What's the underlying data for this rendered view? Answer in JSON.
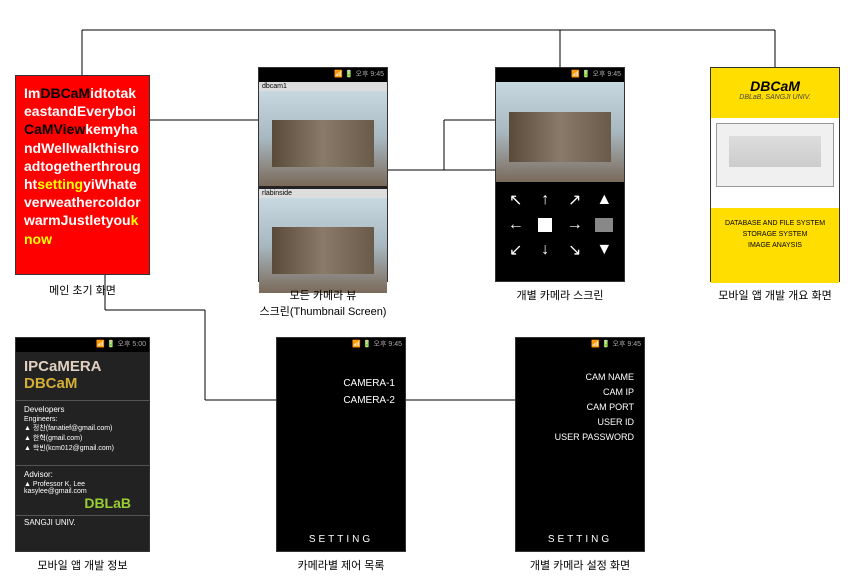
{
  "statusbar_text": "📶 🔋 오후 9:45",
  "main_screen": {
    "text_full": "ImDBCaMidtotakeastandEveryboiCaMViewkemyhandWellwalkthisroadtogetherthroughtsettingyiWhateverweathercoldorwarmJustletyouknow",
    "highlights": {
      "dbcam": "DBCaM",
      "camview": "CaMView",
      "setting": "setting",
      "know": "know"
    },
    "label": "메인 초기 화면"
  },
  "thumb_screen": {
    "cam1_label": "dbcam1",
    "cam2_label": "rlabinside",
    "label": "모든 카메라 뷰\n스크린(Thumbnail Screen)"
  },
  "indiv_screen": {
    "label": "개별 카메라 스크린",
    "arrows": [
      "↖",
      "↑",
      "↗",
      "⬆",
      "←",
      "■",
      "→",
      "🏠",
      "↙",
      "↓",
      "↘",
      "⬇"
    ]
  },
  "overview_screen": {
    "title": "DBCaM",
    "subtitle": "DBLaB, SANGJI UNIV.",
    "lines": [
      "DATABASE AND FILE SYSTEM",
      "STORAGE SYSTEM",
      "IMAGE ANAYSIS"
    ],
    "label": "모바일 앱 개발 개요 화면"
  },
  "info_screen": {
    "title": "IPCaMERA",
    "brand": "DBCaM",
    "sect1_title": "Developers",
    "sect1_sub": "Engineers:",
    "dev_lines": [
      "▲ 정찬(fanatief@gmail.com)",
      "▲ 한혁(gmail.com)",
      "▲ 학빈(kcm012@gmail.com)"
    ],
    "sect2_title": "Advisor:",
    "advisor_lines": [
      "▲ Professor K. Lee",
      "kasylee@gmail.com"
    ],
    "dblab": "DBLaB",
    "univ": "SANGJI UNIV.",
    "label": "모바일 앱 개발 정보"
  },
  "ctrl_list": {
    "items": [
      "CAMERA-1",
      "CAMERA-2"
    ],
    "footer": "SETTING",
    "label": "카메라별 제어 목록"
  },
  "settings_screen": {
    "items": [
      "CAM NAME",
      "CAM IP",
      "CAM PORT",
      "USER ID",
      "USER PASSWORD"
    ],
    "footer": "SETTING",
    "label": "개별 카메라 설정 화면"
  }
}
